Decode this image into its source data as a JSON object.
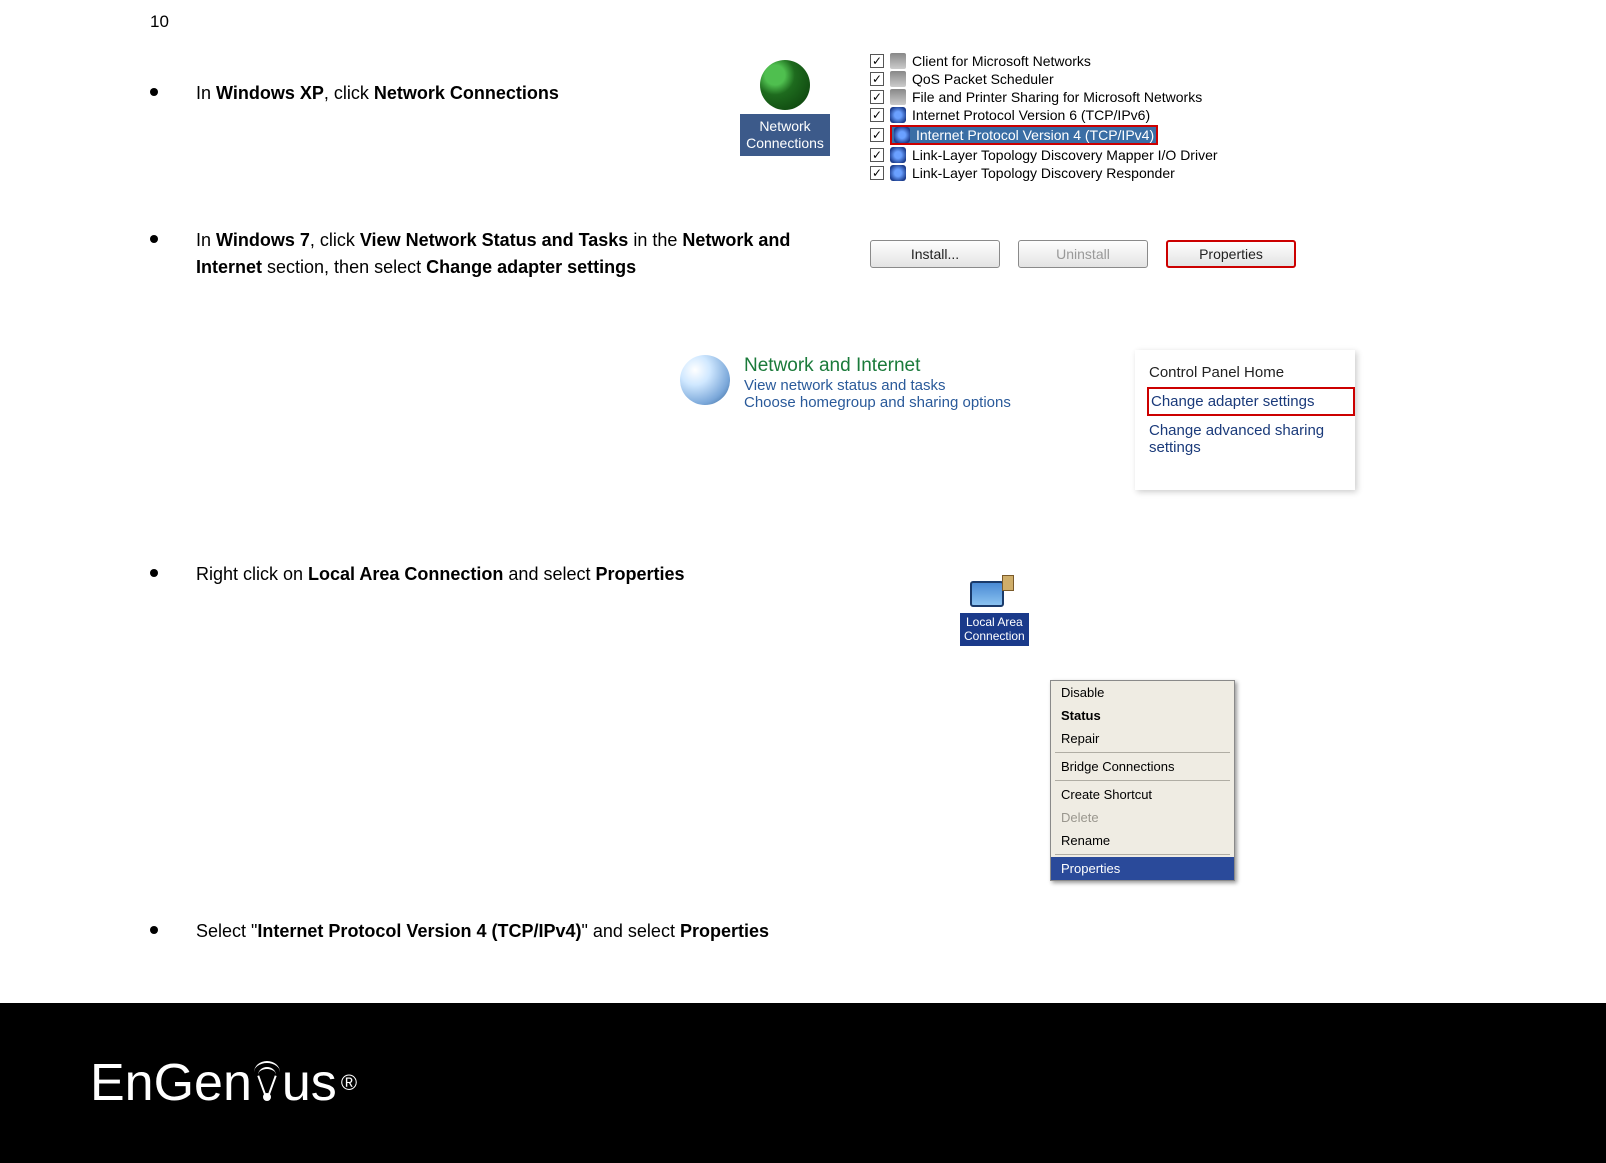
{
  "page_number": "10",
  "bullets": [
    {
      "prefix": "In ",
      "bold1": "Windows XP",
      "mid": ", click ",
      "bold2": "Network Connections",
      "suffix": ""
    },
    {
      "prefix": "In ",
      "bold1": "Windows 7",
      "mid": ", click ",
      "bold2": "View Network Status and Tasks",
      "mid2": " in the ",
      "bold3": "Network and Internet",
      "mid3": " section, then select ",
      "bold4": "Change adapter settings",
      "suffix": ""
    },
    {
      "prefix": "Right click on ",
      "bold1": "Local Area Connection",
      "mid": " and select ",
      "bold2": "Properties",
      "suffix": ""
    },
    {
      "prefix": "Select \"",
      "bold1": "Internet Protocol Version 4 (TCP/IPv4)",
      "mid": "\" and select ",
      "bold2": "Properties",
      "suffix": ""
    }
  ],
  "netconn_label": "Network\nConnections",
  "chk_items": [
    {
      "checked": true,
      "label": "Client for Microsoft Networks"
    },
    {
      "checked": true,
      "label": "QoS Packet Scheduler"
    },
    {
      "checked": true,
      "label": "File and Printer Sharing for Microsoft Networks"
    },
    {
      "checked": true,
      "label": "Internet Protocol Version 6 (TCP/IPv6)"
    },
    {
      "checked": true,
      "label": "Internet Protocol Version 4 (TCP/IPv4)",
      "selected": true
    },
    {
      "checked": true,
      "label": "Link-Layer Topology Discovery Mapper I/O Driver"
    },
    {
      "checked": true,
      "label": "Link-Layer Topology Discovery Responder"
    }
  ],
  "buttons": {
    "install": "Install...",
    "uninstall": "Uninstall",
    "properties": "Properties"
  },
  "win7": {
    "title": "Network and Internet",
    "line1": "View network status and tasks",
    "line2": "Choose homegroup and sharing options"
  },
  "cp_panel": {
    "home": "Control Panel Home",
    "adapter": "Change adapter settings",
    "advanced": "Change advanced sharing settings"
  },
  "lac_label": "Local Area\nConnection",
  "context_menu": [
    {
      "label": "Disable"
    },
    {
      "label": "Status",
      "bold": true
    },
    {
      "label": "Repair"
    },
    {
      "sep": true
    },
    {
      "label": "Bridge Connections"
    },
    {
      "sep": true
    },
    {
      "label": "Create Shortcut"
    },
    {
      "label": "Delete",
      "disabled": true
    },
    {
      "label": "Rename"
    },
    {
      "sep": true
    },
    {
      "label": "Properties",
      "selected": true
    }
  ],
  "logo_text": {
    "part1": "EnGen",
    "part2": "us",
    "reg": "®"
  }
}
